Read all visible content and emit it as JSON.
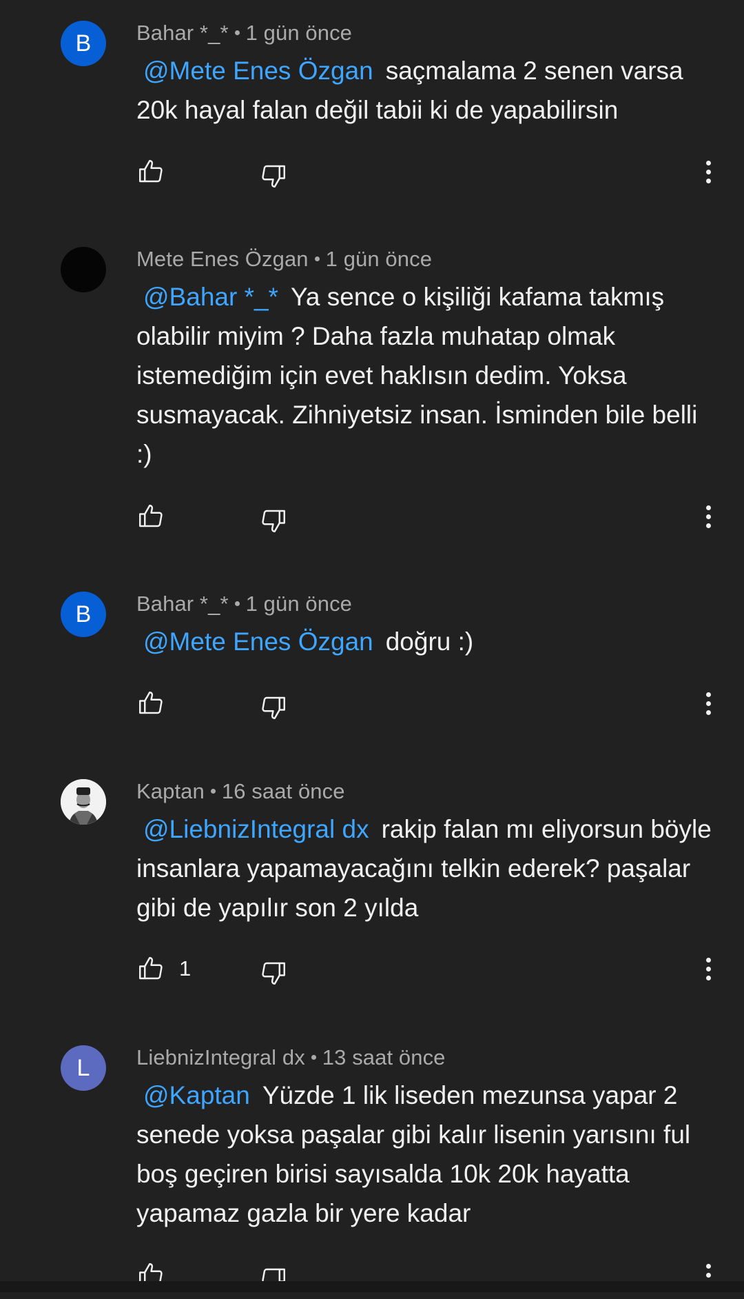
{
  "comments": [
    {
      "avatar_letter": "B",
      "avatar_color": "#065fd4",
      "author": "Bahar *_*",
      "time": "1 gün önce",
      "mention": "@Mete Enes Özgan",
      "text": "saçmalama 2 senen varsa 20k hayal falan değil tabii ki de yapabilirsin",
      "likes": ""
    },
    {
      "avatar_letter": "",
      "avatar_color": "#050505",
      "author": "Mete Enes Özgan",
      "time": "1 gün önce",
      "mention": "@Bahar *_*",
      "text": "Ya sence o kişiliği kafama takmış olabilir miyim ? Daha fazla muhatap olmak istemediğim için evet haklısın dedim. Yoksa susmayacak. Zihniyetsiz insan. İsminden bile belli :)",
      "likes": ""
    },
    {
      "avatar_letter": "B",
      "avatar_color": "#065fd4",
      "author": "Bahar *_*",
      "time": "1 gün önce",
      "mention": "@Mete Enes Özgan",
      "text": "doğru :)",
      "likes": ""
    },
    {
      "avatar_letter": "",
      "avatar_color": "#e8e8e8",
      "author": "Kaptan",
      "time": "16 saat önce",
      "mention": "@LiebnizIntegral dx",
      "text": "rakip falan mı eliyorsun böyle insanlara yapamayacağını telkin ederek? paşalar gibi de yapılır son 2 yılda",
      "likes": "1"
    },
    {
      "avatar_letter": "L",
      "avatar_color": "#5c6bc0",
      "author": "LiebnizIntegral dx",
      "time": "13 saat önce",
      "mention": "@Kaptan",
      "text": "Yüzde 1 lik liseden mezunsa yapar 2 senede yoksa paşalar gibi kalır lisenin yarısını ful boş geçiren birisi sayısalda 10k 20k hayatta yapamaz gazla bir yere kadar",
      "likes": ""
    }
  ],
  "icons": {
    "like": "thumb-up-icon",
    "dislike": "thumb-down-icon",
    "more": "more-vert-icon"
  },
  "colors": {
    "background": "#212121",
    "mention": "#3ea6ff",
    "meta": "#aaaaaa",
    "text": "#f1f1f1"
  }
}
